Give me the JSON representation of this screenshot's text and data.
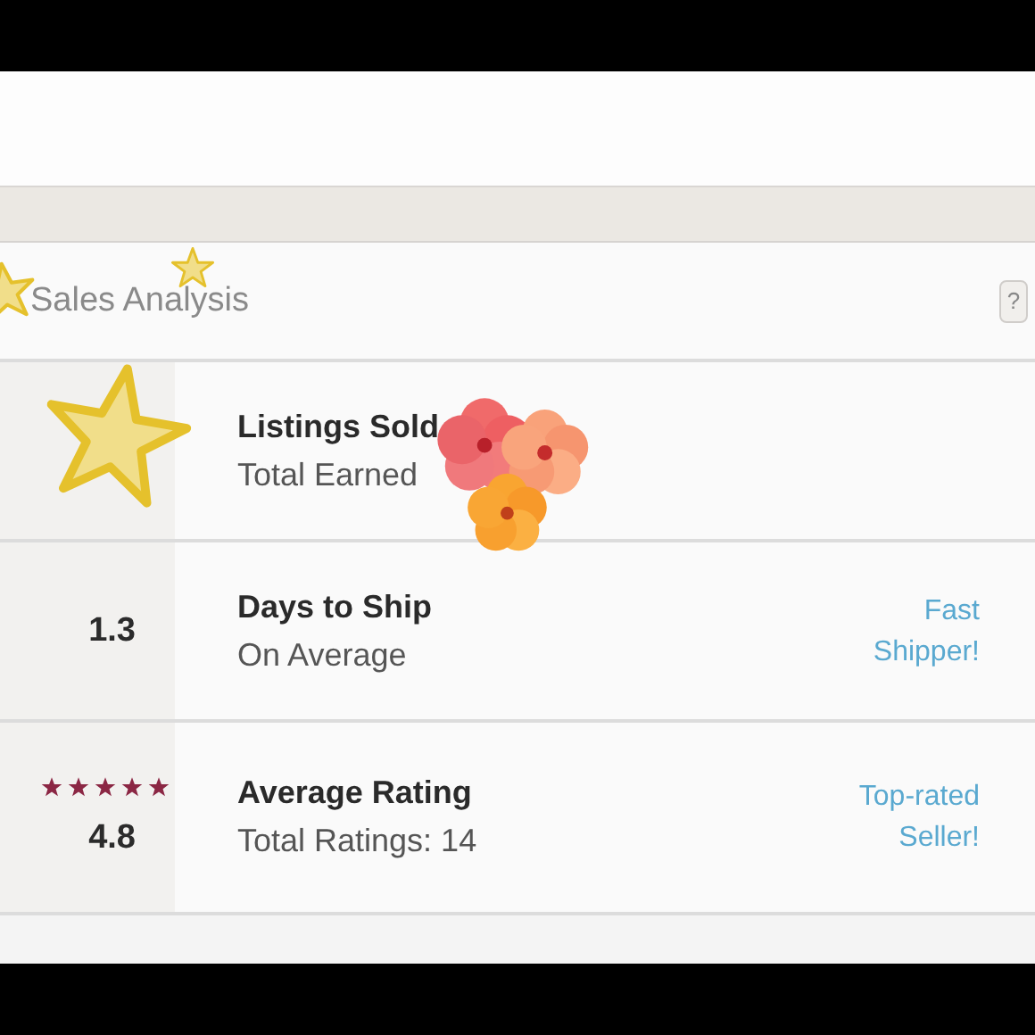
{
  "panel": {
    "title": "Sales Analysis",
    "help": "?"
  },
  "rows": [
    {
      "title": "Listings Sold",
      "subtitle": "Total Earned"
    },
    {
      "value": "1.3",
      "title": "Days to Ship",
      "subtitle": "On Average",
      "badge": "Fast Shipper!"
    },
    {
      "value": "4.8",
      "stars": 5,
      "title": "Average Rating",
      "subtitle": "Total Ratings: 14",
      "badge": "Top-rated Seller!"
    }
  ]
}
